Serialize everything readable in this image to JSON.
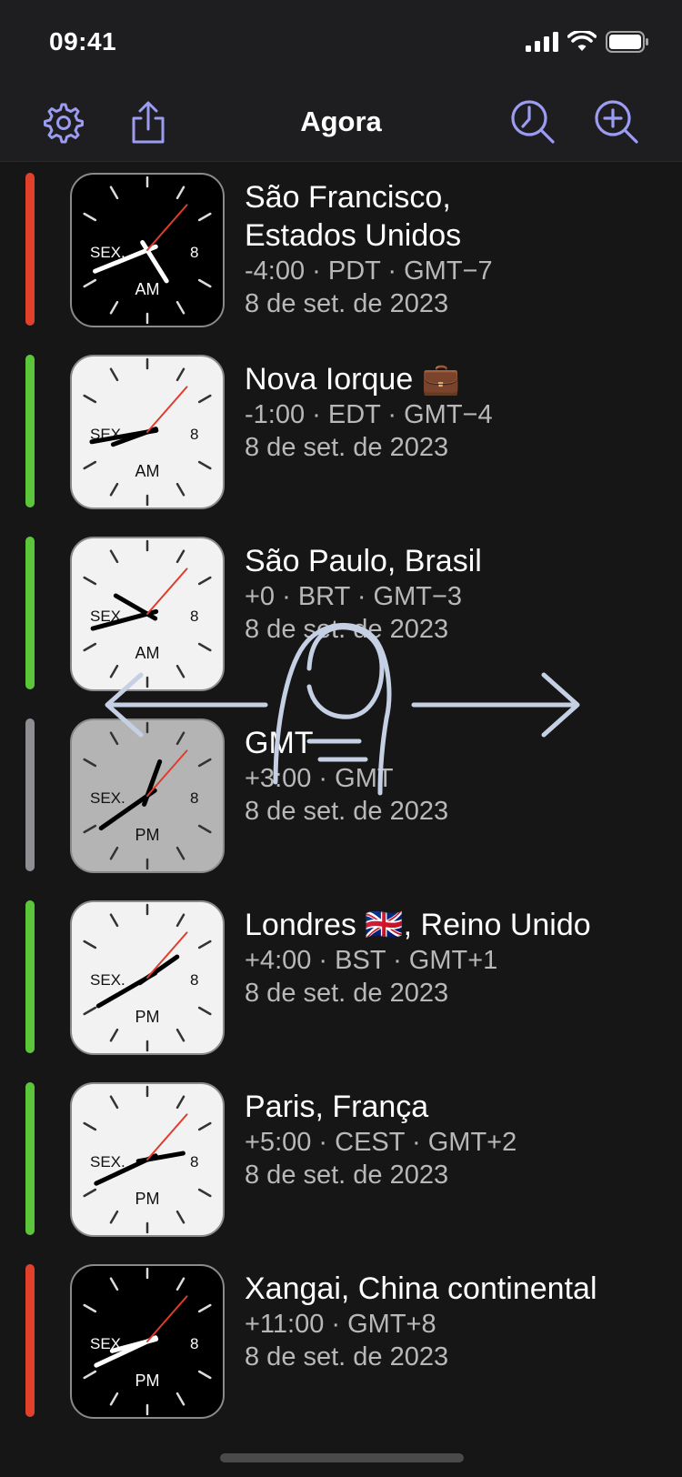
{
  "status_bar": {
    "time": "09:41"
  },
  "nav": {
    "title": "Agora",
    "icons": [
      "gear-icon",
      "share-icon",
      "clock-search-icon",
      "zoom-in-icon"
    ],
    "accent_color": "#9b9cf2"
  },
  "clock_labels": {
    "day": "SEX.",
    "eight": "8"
  },
  "rows": [
    {
      "city": "São Francisco,",
      "city2": "Estados Unidos",
      "tz": "-4:00 · PDT · GMT−7",
      "date": "8 de set. de 2023",
      "period": "AM",
      "bar_color": "#e0402c",
      "face": "dark"
    },
    {
      "city": "Nova Iorque 💼",
      "city2": "",
      "tz": "-1:00 · EDT · GMT−4",
      "date": "8 de set. de 2023",
      "period": "AM",
      "bar_color": "#5cc63a",
      "face": "light"
    },
    {
      "city": "São Paulo, Brasil",
      "city2": "",
      "tz": "+0 · BRT · GMT−3",
      "date": "8 de set. de 2023",
      "period": "AM",
      "bar_color": "#5cc63a",
      "face": "light"
    },
    {
      "city": "GMT",
      "city2": "",
      "tz": "+3:00 · GMT",
      "date": "8 de set. de 2023",
      "period": "PM",
      "bar_color": "#8e8e93",
      "face": "gray"
    },
    {
      "city": "Londres 🇬🇧, Reino Unido",
      "city2": "",
      "tz": "+4:00 · BST · GMT+1",
      "date": "8 de set. de 2023",
      "period": "PM",
      "bar_color": "#5cc63a",
      "face": "light"
    },
    {
      "city": "Paris, França",
      "city2": "",
      "tz": "+5:00 · CEST · GMT+2",
      "date": "8 de set. de 2023",
      "period": "PM",
      "bar_color": "#5cc63a",
      "face": "light"
    },
    {
      "city": "Xangai, China continental",
      "city2": "",
      "tz": "+11:00 · GMT+8",
      "date": "8 de set. de 2023",
      "period": "PM",
      "bar_color": "#e0402c",
      "face": "dark"
    }
  ]
}
